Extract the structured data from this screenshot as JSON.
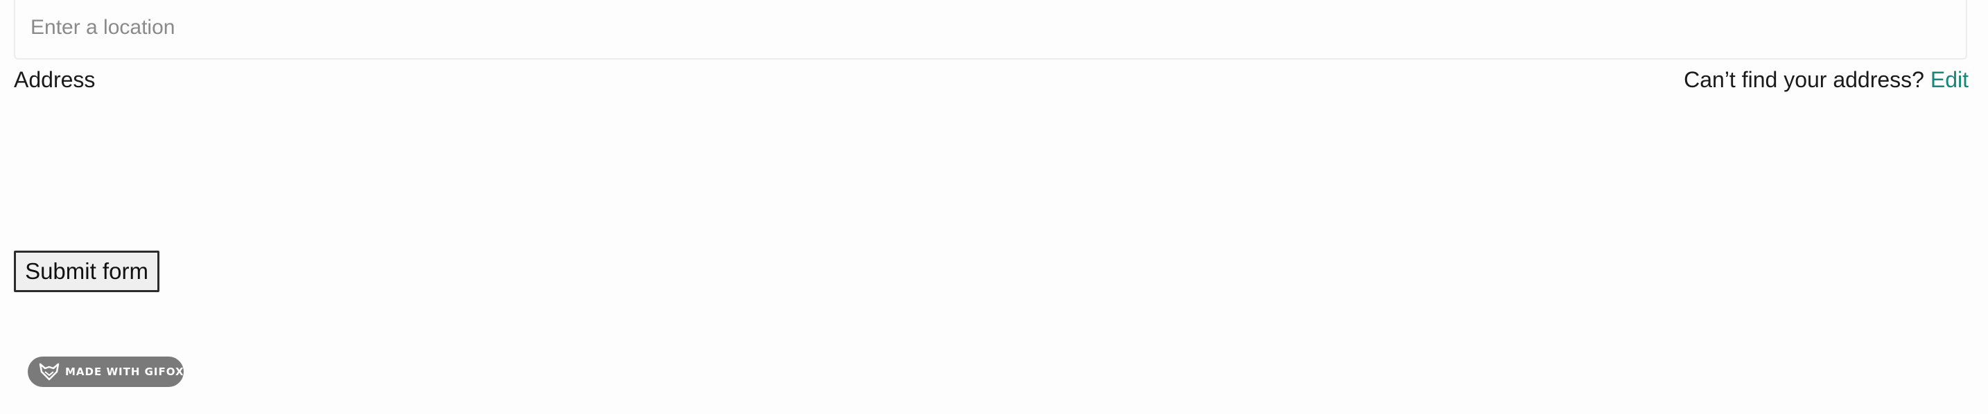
{
  "location_field": {
    "placeholder": "Enter a location",
    "value": ""
  },
  "address": {
    "label": "Address",
    "help_text": "Can’t find your address?",
    "edit_link": "Edit"
  },
  "form": {
    "submit_label": "Submit form"
  },
  "badge": {
    "text": "MADE WITH GIFOX",
    "icon": "fox-icon"
  },
  "colors": {
    "link": "#17877a",
    "badge_bg": "#7a7a7a"
  }
}
